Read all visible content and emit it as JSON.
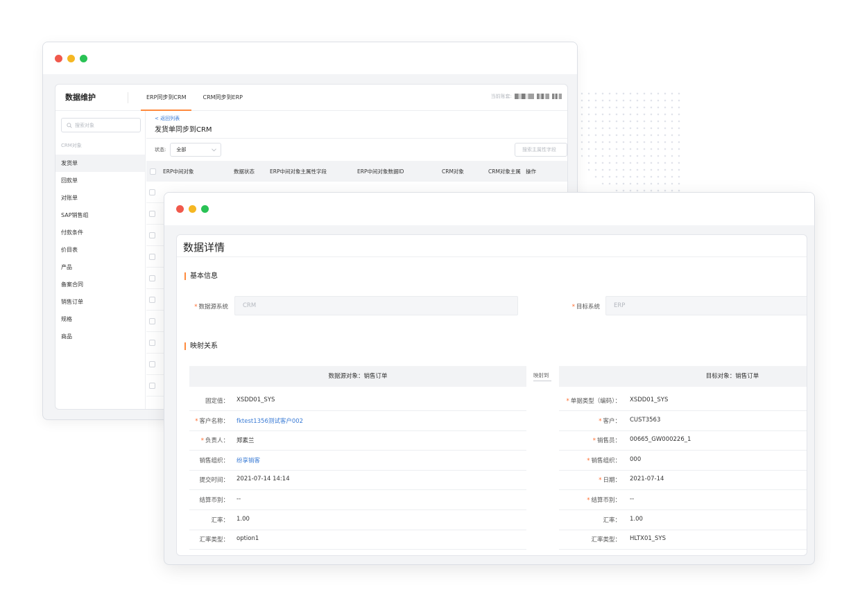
{
  "back_window": {
    "brand": "数据维护",
    "tabs": [
      "ERP同步到CRM",
      "CRM同步到ERP"
    ],
    "account_label": "当前账套:",
    "sidebar": {
      "search_placeholder": "搜索对象",
      "group": "CRM对象",
      "items": [
        "发货单",
        "回款单",
        "对账单",
        "SAP销售组",
        "付款条件",
        "价目表",
        "产品",
        "备案合同",
        "销售订单",
        "规格",
        "商品"
      ]
    },
    "main": {
      "back_link": "< 返回列表",
      "title": "发货单同步到CRM",
      "status_label": "状态:",
      "status_value": "全部",
      "search_placeholder": "搜索主属性字段",
      "columns": [
        "ERP中间对象",
        "数据状态",
        "ERP中间对象主属性字段",
        "ERP中间对象数据ID",
        "CRM对象",
        "CRM对象主属",
        "操作"
      ]
    }
  },
  "front_window": {
    "title": "数据详情",
    "basic_section": "基本信息",
    "source_system_label": "数据源系统",
    "source_system_value": "CRM",
    "target_system_label": "目标系统",
    "target_system_value": "ERP",
    "mapping_section": "映射关系",
    "source_object_header": "数据源对象：销售订单",
    "mapping_arrow": "映射到",
    "target_object_header": "目标对象：销售订单",
    "source_fields": [
      {
        "label": "固定值：",
        "value": "XSDD01_SYS",
        "required": false,
        "link": false
      },
      {
        "label": "客户名称：",
        "value": "fktest1356测试客户002",
        "required": true,
        "link": true
      },
      {
        "label": "负责人：",
        "value": "郑素兰",
        "required": true,
        "link": false
      },
      {
        "label": "销售组织：",
        "value": "纷享销客",
        "required": false,
        "link": true
      },
      {
        "label": "提交时间：",
        "value": "2021-07-14 14:14",
        "required": false,
        "link": false
      },
      {
        "label": "结算币别：",
        "value": "--",
        "required": false,
        "link": false
      },
      {
        "label": "汇率：",
        "value": "1.00",
        "required": false,
        "link": false
      },
      {
        "label": "汇率类型：",
        "value": "option1",
        "required": false,
        "link": false
      }
    ],
    "target_fields": [
      {
        "label": "单据类型（编码）：",
        "value": "XSDD01_SYS",
        "required": true
      },
      {
        "label": "客户：",
        "value": "CUST3563",
        "required": true
      },
      {
        "label": "销售员：",
        "value": "00665_GW000226_1",
        "required": true
      },
      {
        "label": "销售组织：",
        "value": "000",
        "required": true
      },
      {
        "label": "日期：",
        "value": "2021-07-14",
        "required": true
      },
      {
        "label": "结算币别：",
        "value": "--",
        "required": true
      },
      {
        "label": "汇率：",
        "value": "1.00",
        "required": false
      },
      {
        "label": "汇率类型：",
        "value": "HLTX01_SYS",
        "required": false
      }
    ]
  }
}
